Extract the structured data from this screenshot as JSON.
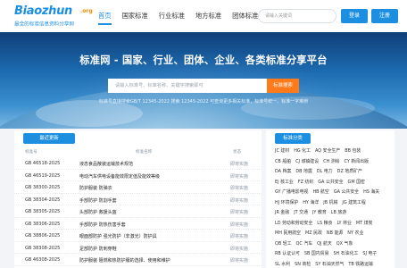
{
  "logo": {
    "main": "Biaozhun",
    "org": ".org",
    "sub": "最全的标准信息资料分享网"
  },
  "nav": {
    "items": [
      "首页",
      "国家标准",
      "行业标准",
      "地方标准",
      "团体标准"
    ]
  },
  "header": {
    "search_placeholder": "请输入关键词",
    "login": "登录",
    "register": "注册"
  },
  "hero": {
    "title": "标准网 - 国家、行业、团体、企业、各类标准分享平台",
    "search_placeholder": "请输入标准号、标准名称、关键字搜索即可",
    "search_button": "标准搜索",
    "hint": "标准号直接搜索GB/T 12345-2022 搜索 12345-2022 可查询更多相关标准，标准号统一、标准一字难辨"
  },
  "latest": {
    "tab": "最近更新",
    "headers": {
      "no": "标准号",
      "name": "标准名称",
      "status": "状态"
    },
    "rows": [
      {
        "no": "GB 46518-2025",
        "name": "液态食品散装运输技术规范",
        "status": "即将实施"
      },
      {
        "no": "GB 46519-2025",
        "name": "电动汽车供电设备能效限定值及能效等级",
        "status": "即将实施"
      },
      {
        "no": "GB 38300-2025",
        "name": "防护服装 防弹衣",
        "status": "即将实施"
      },
      {
        "no": "GB 38304-2025",
        "name": "手部防护 防割手套",
        "status": "即将实施"
      },
      {
        "no": "GB 38305-2025",
        "name": "头部防护 救援头盔",
        "status": "即将实施"
      },
      {
        "no": "GB 38306-2025",
        "name": "手部防护 防热伤害手套",
        "status": "即将实施"
      },
      {
        "no": "GB 38806-2025",
        "name": "眼面部防护 强光防护（非激光）防护具",
        "status": "即将实施"
      },
      {
        "no": "GB 38308-2025",
        "name": "足部防护 防刺穿鞋",
        "status": "即将实施"
      },
      {
        "no": "GB 46308-2025",
        "name": "防护服装 阻燃和热防护服的选择、使用和维护",
        "status": "即将实施"
      }
    ]
  },
  "categories": {
    "tab": "标准分类",
    "rows": [
      [
        "JC 建材",
        "HG 化工",
        "AQ 安全生产",
        "BB 包装"
      ],
      [
        "CB 船舶",
        "CJ 城镇建设",
        "CH 测绘",
        "CY 新闻出版"
      ],
      [
        "DA 档案",
        "DB 地震",
        "DL 电力",
        "DZ 地质矿产"
      ],
      [
        "EJ 核工业",
        "FZ 纺织",
        "GA 公共安全",
        "GM 国密"
      ],
      [
        "GY 广播电影电视",
        "HB 航空",
        "GA 公共安全",
        "HS 海关"
      ],
      [
        "HJ 环境保护",
        "HY 海洋",
        "JB 机械",
        "JG 建筑工程"
      ],
      [
        "JR 金融",
        "JT 交通",
        "JY 教育",
        "LB 旅游"
      ],
      [
        "LD 劳动和劳动安全",
        "LS 粮食",
        "LY 林业",
        "MT 煤炭"
      ],
      [
        "MH 民用航空",
        "MZ 民政",
        "NB 能源",
        "NY 农业"
      ],
      [
        "QB 轻工",
        "QC 汽车",
        "QJ 航天",
        "QX 气象"
      ],
      [
        "RB 认证认可",
        "SB 国内贸易",
        "SH 石油化工",
        "SJ 电子"
      ],
      [
        "SL 水利",
        "SN 商检",
        "SY 石油天然气",
        "TB 铁路运输"
      ]
    ]
  }
}
